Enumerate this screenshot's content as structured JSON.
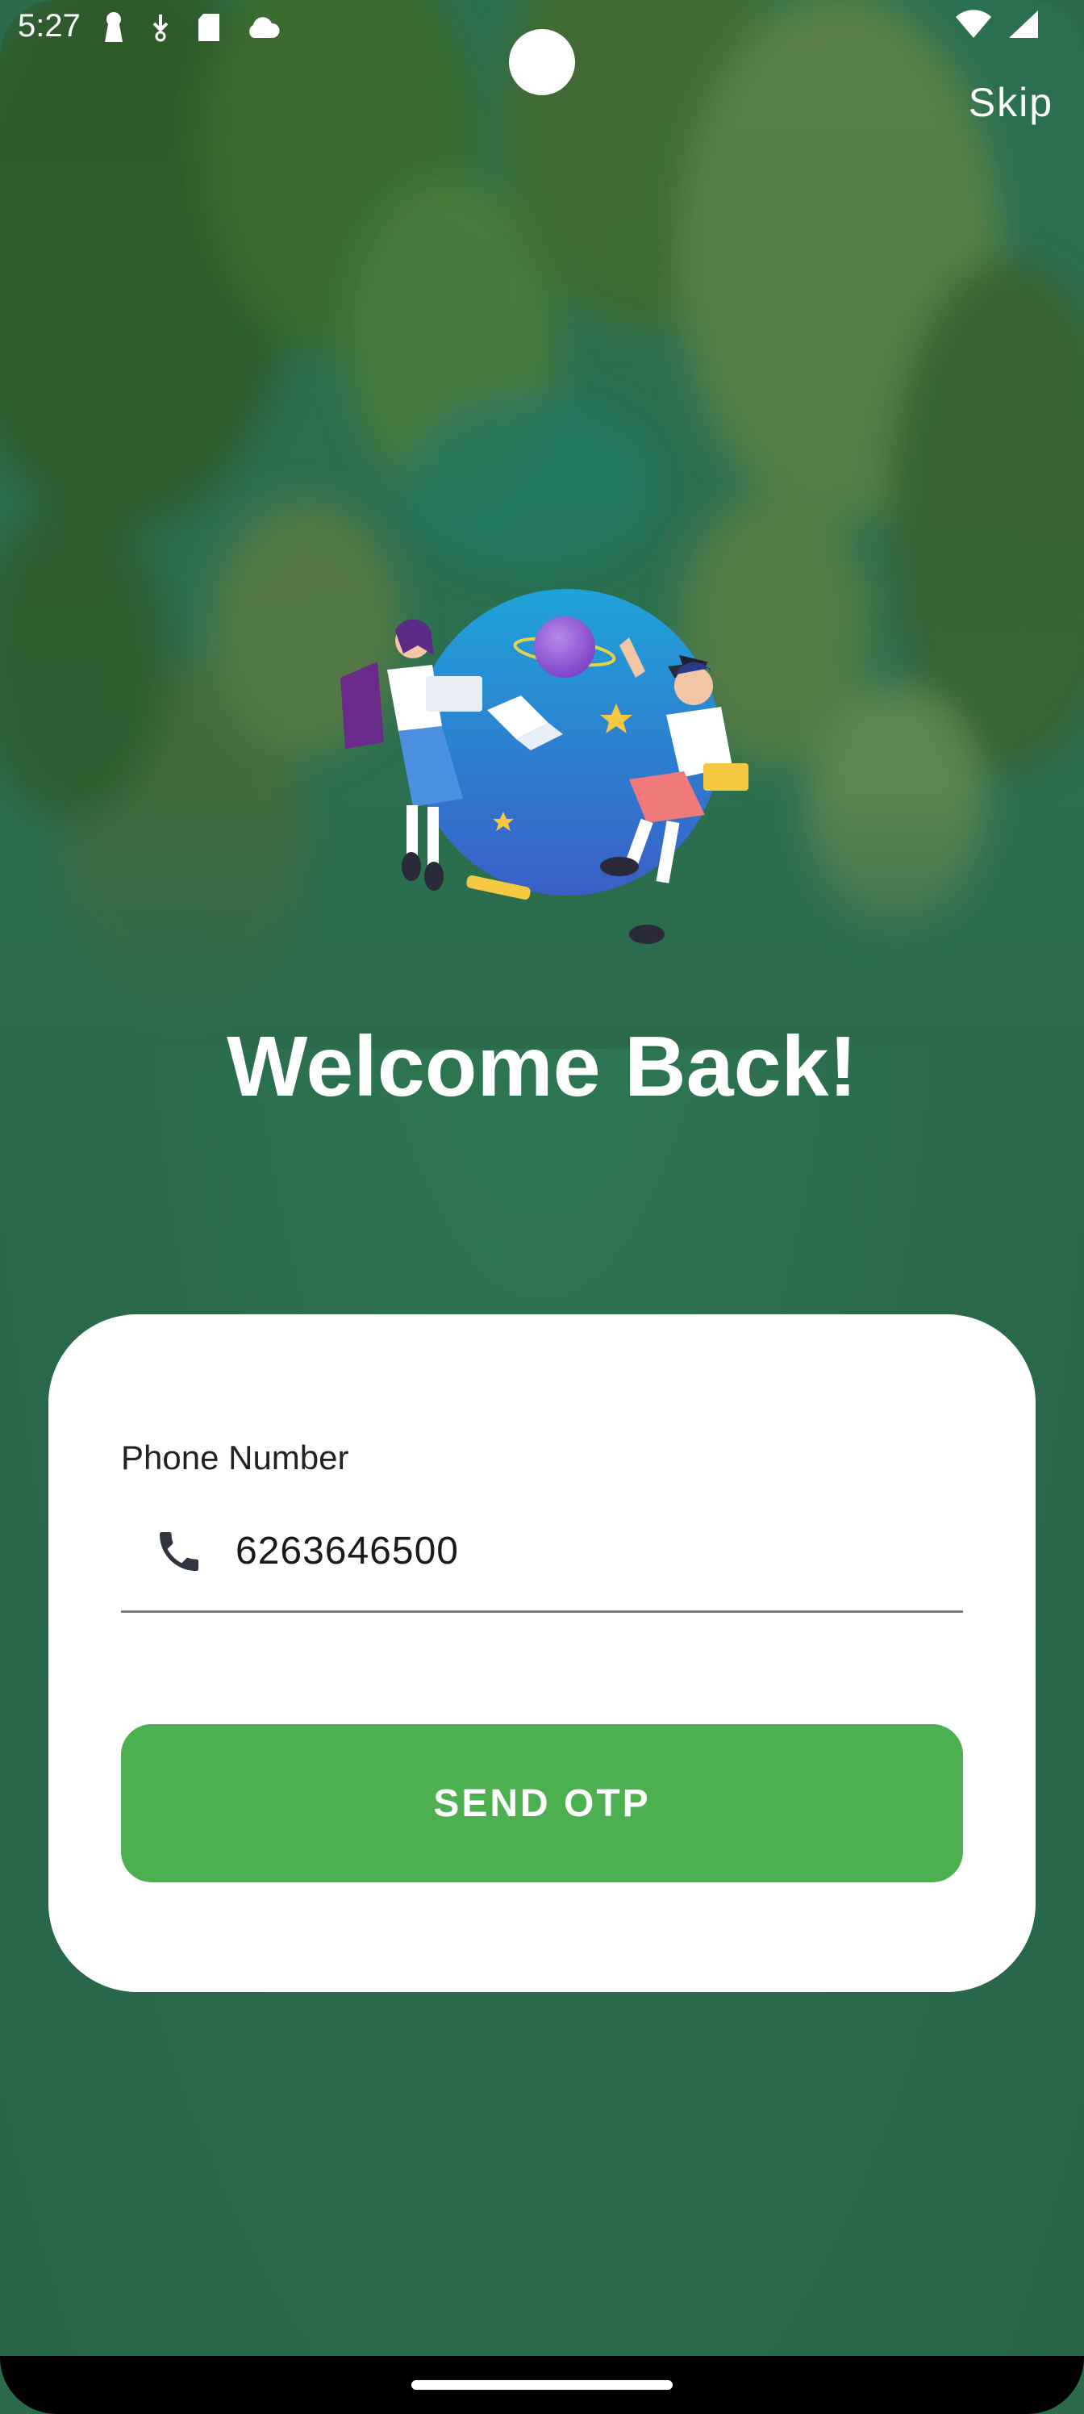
{
  "status_bar": {
    "time": "5:27",
    "left_icons": [
      "keyhole-icon",
      "download-icon",
      "sd-card-icon",
      "cloud-icon"
    ],
    "right_icons": [
      "wifi-icon",
      "signal-icon"
    ]
  },
  "header": {
    "skip_label": "Skip"
  },
  "hero": {
    "illustration": "students-globe-illustration",
    "title": "Welcome Back!"
  },
  "form": {
    "phone_label": "Phone Number",
    "phone_value": "6263646500",
    "phone_icon": "phone-icon",
    "send_button": "SEND OTP"
  },
  "colors": {
    "background": "#2b6b4c",
    "button": "#4caf50",
    "card": "#ffffff",
    "text_light": "#ffffff"
  }
}
